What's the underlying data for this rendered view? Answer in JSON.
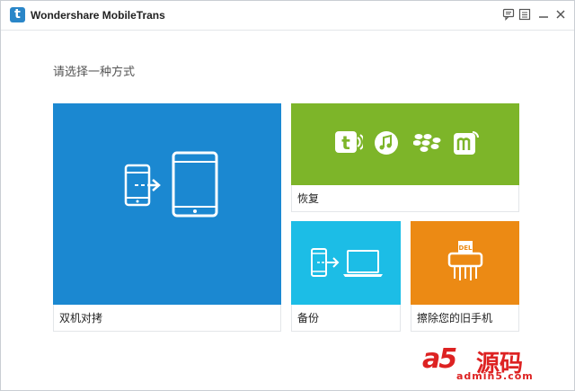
{
  "window": {
    "title": "Wondershare MobileTrans",
    "logo_letter": "t",
    "buttons": {
      "feedback_icon": "feedback-icon",
      "menu_icon": "menu-icon",
      "minimize_icon": "minimize-icon",
      "close_icon": "close-icon"
    }
  },
  "main": {
    "subtitle": "请选择一种方式",
    "tiles": {
      "transfer": {
        "label": "双机对拷",
        "color": "#1b88d1",
        "icon": "phone-to-tablet-icon"
      },
      "restore": {
        "label": "恢复",
        "color": "#7db529",
        "icons": [
          "mobiletrans-icon",
          "itunes-icon",
          "blackberry-icon",
          "mobiletrans-m-icon"
        ]
      },
      "backup": {
        "label": "备份",
        "color": "#1cbde6",
        "icon": "phone-to-laptop-icon"
      },
      "erase": {
        "label": "擦除您的旧手机",
        "color": "#ec8a14",
        "icon": "shredder-del-icon",
        "icon_text": "DEL"
      }
    }
  },
  "watermark": {
    "brand": "a5",
    "cn_text": "源码",
    "url": "admin5.com"
  }
}
